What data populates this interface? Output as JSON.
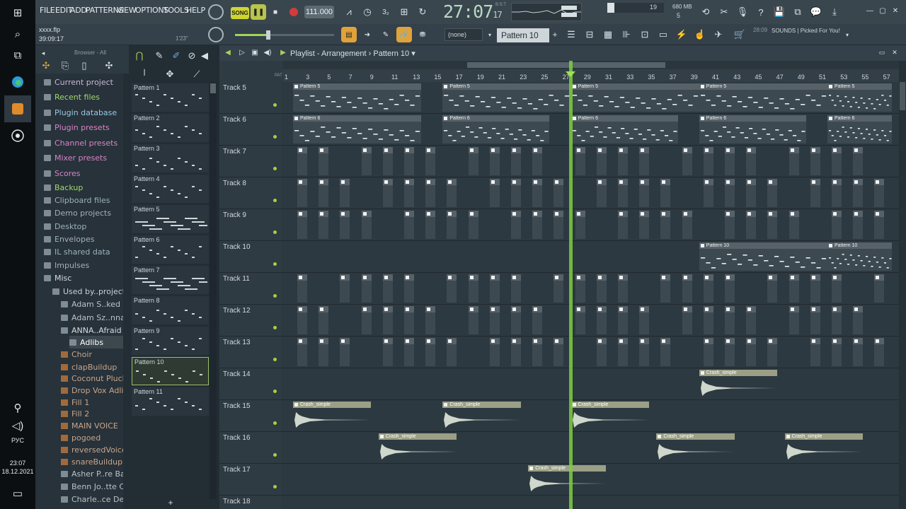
{
  "taskbar": {
    "lang": "РУС",
    "time": "23:07",
    "date": "18.12.2021",
    "icons": [
      "windows-icon",
      "search-icon",
      "task-view-icon",
      "edge-icon",
      "fl-studio-icon",
      "obs-icon"
    ]
  },
  "menu": [
    "FILE",
    "EDIT",
    "ADD",
    "PATTERNS",
    "VIEW",
    "OPTIONS",
    "TOOLS",
    "HELP"
  ],
  "transport": {
    "mode": "SONG",
    "tempo": "111.000",
    "time_main": "27:07",
    "time_sub": "17",
    "time_unit": "B:S:T",
    "memory": "680 MB",
    "cpu": "19",
    "poly": "5"
  },
  "project": {
    "file": "xxxx.flp",
    "elapsed": "39:09:17",
    "cursor_time": "1'23\""
  },
  "toolbar2": {
    "snap": "(none)",
    "pattern": "Pattern 10",
    "news_time": "28:09",
    "news_text": "SOUNDS | Picked For You!"
  },
  "browser": {
    "title": "Browser - All",
    "items": [
      {
        "label": "Current project",
        "color": "#c9b6d6"
      },
      {
        "label": "Recent files",
        "color": "#9fd96a"
      },
      {
        "label": "Plugin database",
        "color": "#9bc7e6"
      },
      {
        "label": "Plugin presets",
        "color": "#d984c8"
      },
      {
        "label": "Channel presets",
        "color": "#d984c8"
      },
      {
        "label": "Mixer presets",
        "color": "#d984c8"
      },
      {
        "label": "Scores",
        "color": "#d984c8"
      },
      {
        "label": "Backup",
        "color": "#9fd96a"
      },
      {
        "label": "Clipboard files",
        "color": "#9db2bd"
      },
      {
        "label": "Demo projects",
        "color": "#9db2bd"
      },
      {
        "label": "Desktop",
        "color": "#9db2bd"
      },
      {
        "label": "Envelopes",
        "color": "#9db2bd"
      },
      {
        "label": "IL shared data",
        "color": "#9db2bd"
      },
      {
        "label": "Impulses",
        "color": "#9db2bd"
      },
      {
        "label": "Misc",
        "color": "#d6dde0"
      },
      {
        "label": "Used by..projects",
        "color": "#c8d1d6"
      },
      {
        "label": "Adam S..ked Out",
        "color": "#b8c3c9"
      },
      {
        "label": "Adam Sz..nna Be",
        "color": "#b8c3c9"
      },
      {
        "label": "ANNA..Afraid",
        "color": "#d6dde0"
      },
      {
        "label": "Adlibs",
        "color": "#ffffff"
      },
      {
        "label": "Choir",
        "color": "#c9a58c"
      },
      {
        "label": "clapBuildup",
        "color": "#c9a58c"
      },
      {
        "label": "Coconut Pluck",
        "color": "#c9a58c"
      },
      {
        "label": "Drop Vox Adlibs",
        "color": "#c9a58c"
      },
      {
        "label": "Fill 1",
        "color": "#c9a58c"
      },
      {
        "label": "Fill 2",
        "color": "#c9a58c"
      },
      {
        "label": "MAIN VOICE",
        "color": "#c9a58c"
      },
      {
        "label": "pogoed",
        "color": "#c9a58c"
      },
      {
        "label": "reversedVoice",
        "color": "#c9a58c"
      },
      {
        "label": "snareBuildup",
        "color": "#c9a58c"
      },
      {
        "label": "Asher P..re Bass",
        "color": "#b8c3c9"
      },
      {
        "label": "Benn Jo..tte Cafe",
        "color": "#b8c3c9"
      },
      {
        "label": "Charle..ce Demo",
        "color": "#b8c3c9"
      }
    ]
  },
  "patterns": [
    "Pattern 1",
    "Pattern 2",
    "Pattern 3",
    "Pattern 4",
    "Pattern 5",
    "Pattern 6",
    "Pattern 7",
    "Pattern 8",
    "Pattern 9",
    "Pattern 10",
    "Pattern 11"
  ],
  "selected_pattern": 9,
  "playlist": {
    "title": "Playlist - Arrangement",
    "pattern": "Pattern 10"
  },
  "ruler": {
    "pat_label": "PAT",
    "bars": [
      "1",
      "3",
      "5",
      "7",
      "9",
      "11",
      "13",
      "15",
      "17",
      "19",
      "21",
      "23",
      "25",
      "27",
      "29",
      "31",
      "33",
      "35",
      "37",
      "39",
      "41",
      "43",
      "45",
      "47",
      "49",
      "51",
      "53",
      "55",
      "57"
    ]
  },
  "playhead_bar": 27,
  "tracks": [
    {
      "label": "Track 5",
      "clips": [
        {
          "name": "Pattern 5",
          "start": 1,
          "len": 12
        },
        {
          "name": "Pattern 5",
          "start": 15,
          "len": 12
        },
        {
          "name": "Pattern 5",
          "start": 27,
          "len": 12
        },
        {
          "name": "Pattern 5",
          "start": 39,
          "len": 12
        },
        {
          "name": "Pattern 5",
          "start": 51,
          "len": 6
        }
      ]
    },
    {
      "label": "Track 6",
      "clips": [
        {
          "name": "Pattern 6",
          "start": 1,
          "len": 12
        },
        {
          "name": "Pattern 6",
          "start": 15,
          "len": 10
        },
        {
          "name": "Pattern 6",
          "start": 27,
          "len": 10
        },
        {
          "name": "Pattern 6",
          "start": 39,
          "len": 10
        },
        {
          "name": "Pattern 6",
          "start": 51,
          "len": 6
        }
      ]
    },
    {
      "label": "Track 7",
      "clips": []
    },
    {
      "label": "Track 8",
      "clips": []
    },
    {
      "label": "Track 9",
      "clips": []
    },
    {
      "label": "Track 10",
      "clips": [
        {
          "name": "Pattern 10",
          "start": 39,
          "len": 12
        },
        {
          "name": "Pattern 10",
          "start": 51,
          "len": 6
        }
      ]
    },
    {
      "label": "Track 11",
      "clips": []
    },
    {
      "label": "Track 12",
      "clips": []
    },
    {
      "label": "Track 13",
      "clips": []
    },
    {
      "label": "Track 14",
      "clips": [
        {
          "name": "Crash_simple",
          "start": 39,
          "len": 7.3
        }
      ]
    },
    {
      "label": "Track 15",
      "clips": [
        {
          "name": "Crash_simple",
          "start": 1,
          "len": 7.3
        },
        {
          "name": "Crash_simple",
          "start": 15,
          "len": 7.3
        },
        {
          "name": "Crash_simple",
          "start": 27,
          "len": 7.3
        }
      ]
    },
    {
      "label": "Track 16",
      "clips": [
        {
          "name": "Crash_simple",
          "start": 9,
          "len": 7.3
        },
        {
          "name": "Crash_simple",
          "start": 35,
          "len": 7.3
        },
        {
          "name": "Crash_simple",
          "start": 47,
          "len": 7.3
        }
      ]
    },
    {
      "label": "Track 17",
      "clips": [
        {
          "name": "Crash_simple",
          "start": 23,
          "len": 7.3
        }
      ]
    },
    {
      "label": "Track 18",
      "clips": []
    }
  ]
}
